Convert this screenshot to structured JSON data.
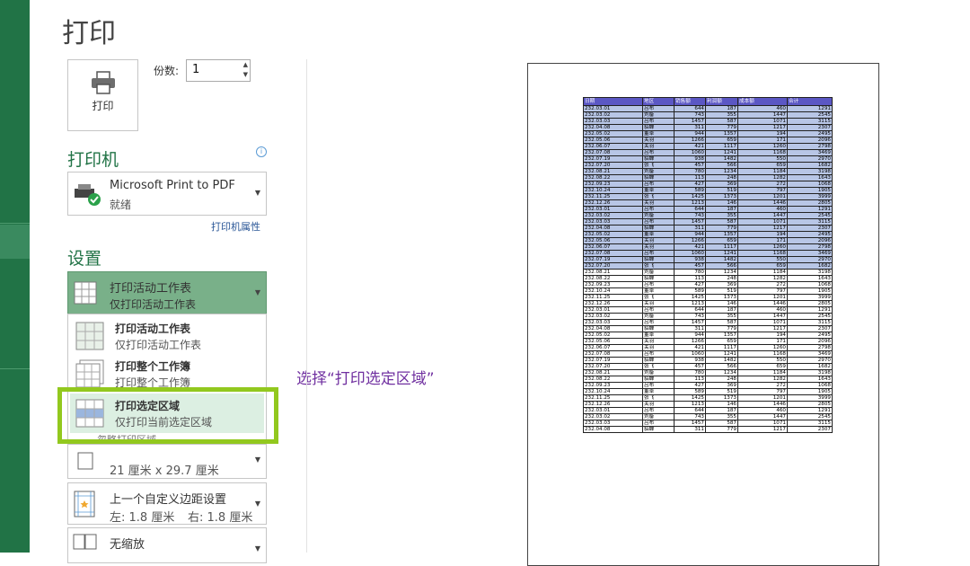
{
  "page_title": "打印",
  "print_button": {
    "label": "打印"
  },
  "copies": {
    "label": "份数:",
    "value": "1"
  },
  "printer": {
    "section_title": "打印机",
    "name": "Microsoft Print to PDF",
    "status": "就绪",
    "properties_link": "打印机属性"
  },
  "settings": {
    "section_title": "设置",
    "selected": {
      "title": "打印活动工作表",
      "subtitle": "仅打印活动工作表"
    },
    "menu": [
      {
        "title": "打印活动工作表",
        "subtitle": "仅打印活动工作表"
      },
      {
        "title": "打印整个工作簿",
        "subtitle": "打印整个工作簿"
      },
      {
        "title": "打印选定区域",
        "subtitle": "仅打印当前选定区域"
      }
    ],
    "menu_footer": "忽略打印区域",
    "paper_size": "21 厘米 x 29.7 厘米",
    "margins": {
      "title": "上一个自定义边距设置",
      "left": "左: 1.8 厘米",
      "right": "右: 1.8 厘米"
    },
    "scaling": "无缩放"
  },
  "annotation": "选择“打印选定区域”",
  "preview": {
    "headers": [
      "日期",
      "地区",
      "销售额",
      "利润额",
      "成本额",
      "合计"
    ],
    "highlighted_rows": 26,
    "rows": [
      [
        "232.03.01",
        "吕布",
        "644",
        "187",
        "460",
        "1291"
      ],
      [
        "232.03.02",
        "刘备",
        "743",
        "355",
        "1447",
        "2545"
      ],
      [
        "232.03.03",
        "吕布",
        "1457",
        "587",
        "1071",
        "3115"
      ],
      [
        "232.04.08",
        "貂蝉",
        "311",
        "779",
        "1217",
        "2307"
      ],
      [
        "232.05.02",
        "董卓",
        "944",
        "1357",
        "194",
        "2495"
      ],
      [
        "232.05.06",
        "关羽",
        "1266",
        "659",
        "171",
        "2096"
      ],
      [
        "232.06.07",
        "关羽",
        "421",
        "1117",
        "1260",
        "2798"
      ],
      [
        "232.07.08",
        "吕布",
        "1060",
        "1241",
        "1168",
        "3469"
      ],
      [
        "232.07.19",
        "貂蝉",
        "938",
        "1482",
        "550",
        "2970"
      ],
      [
        "232.07.20",
        "张飞",
        "457",
        "566",
        "659",
        "1682"
      ],
      [
        "232.08.21",
        "刘备",
        "780",
        "1234",
        "1184",
        "3198"
      ],
      [
        "232.08.22",
        "貂蝉",
        "113",
        "248",
        "1282",
        "1643"
      ],
      [
        "232.09.23",
        "吕布",
        "427",
        "369",
        "272",
        "1068"
      ],
      [
        "232.10.24",
        "董卓",
        "589",
        "519",
        "797",
        "1905"
      ],
      [
        "232.11.25",
        "张飞",
        "1425",
        "1373",
        "1201",
        "3999"
      ],
      [
        "232.12.26",
        "关羽",
        "1213",
        "146",
        "1446",
        "2805"
      ],
      [
        "232.03.01",
        "吕布",
        "644",
        "187",
        "460",
        "1291"
      ],
      [
        "232.03.02",
        "刘备",
        "743",
        "355",
        "1447",
        "2545"
      ],
      [
        "232.03.03",
        "吕布",
        "1457",
        "587",
        "1071",
        "3115"
      ],
      [
        "232.04.08",
        "貂蝉",
        "311",
        "779",
        "1217",
        "2307"
      ],
      [
        "232.05.02",
        "董卓",
        "944",
        "1357",
        "194",
        "2495"
      ],
      [
        "232.05.06",
        "关羽",
        "1266",
        "659",
        "171",
        "2096"
      ],
      [
        "232.06.07",
        "关羽",
        "421",
        "1117",
        "1260",
        "2798"
      ],
      [
        "232.07.08",
        "吕布",
        "1060",
        "1241",
        "1168",
        "3469"
      ],
      [
        "232.07.19",
        "貂蝉",
        "938",
        "1482",
        "550",
        "2970"
      ],
      [
        "232.07.20",
        "张飞",
        "457",
        "566",
        "659",
        "1682"
      ],
      [
        "232.08.21",
        "刘备",
        "780",
        "1234",
        "1184",
        "3198"
      ],
      [
        "232.08.22",
        "貂蝉",
        "113",
        "248",
        "1282",
        "1643"
      ],
      [
        "232.09.23",
        "吕布",
        "427",
        "369",
        "272",
        "1068"
      ],
      [
        "232.10.24",
        "董卓",
        "589",
        "519",
        "797",
        "1905"
      ],
      [
        "232.11.25",
        "张飞",
        "1425",
        "1373",
        "1201",
        "3999"
      ],
      [
        "232.12.26",
        "关羽",
        "1213",
        "146",
        "1446",
        "2805"
      ],
      [
        "232.03.01",
        "吕布",
        "644",
        "187",
        "460",
        "1291"
      ],
      [
        "232.03.02",
        "刘备",
        "743",
        "355",
        "1447",
        "2545"
      ],
      [
        "232.03.03",
        "吕布",
        "1457",
        "587",
        "1071",
        "3115"
      ],
      [
        "232.04.08",
        "貂蝉",
        "311",
        "779",
        "1217",
        "2307"
      ],
      [
        "232.05.02",
        "董卓",
        "944",
        "1357",
        "194",
        "2495"
      ],
      [
        "232.05.06",
        "关羽",
        "1266",
        "659",
        "171",
        "2096"
      ],
      [
        "232.06.07",
        "关羽",
        "421",
        "1117",
        "1260",
        "2798"
      ],
      [
        "232.07.08",
        "吕布",
        "1060",
        "1241",
        "1168",
        "3469"
      ],
      [
        "232.07.19",
        "貂蝉",
        "938",
        "1482",
        "550",
        "2970"
      ],
      [
        "232.07.20",
        "张飞",
        "457",
        "566",
        "659",
        "1682"
      ],
      [
        "232.08.21",
        "刘备",
        "780",
        "1234",
        "1184",
        "3198"
      ],
      [
        "232.08.22",
        "貂蝉",
        "113",
        "248",
        "1282",
        "1643"
      ],
      [
        "232.09.23",
        "吕布",
        "427",
        "369",
        "272",
        "1068"
      ],
      [
        "232.10.24",
        "董卓",
        "589",
        "519",
        "797",
        "1905"
      ],
      [
        "232.11.25",
        "张飞",
        "1425",
        "1373",
        "1201",
        "3999"
      ],
      [
        "232.12.26",
        "关羽",
        "1213",
        "146",
        "1446",
        "2805"
      ],
      [
        "232.03.01",
        "吕布",
        "644",
        "187",
        "460",
        "1291"
      ],
      [
        "232.03.02",
        "刘备",
        "743",
        "355",
        "1447",
        "2545"
      ],
      [
        "232.03.03",
        "吕布",
        "1457",
        "587",
        "1071",
        "3115"
      ],
      [
        "232.04.08",
        "貂蝉",
        "311",
        "779",
        "1217",
        "2307"
      ]
    ]
  },
  "colors": {
    "accent": "#217346",
    "highlight_border": "#92c81e",
    "annotation": "#7030a0",
    "header": "#5b57c4",
    "row_highlight": "#b8c6e6"
  }
}
